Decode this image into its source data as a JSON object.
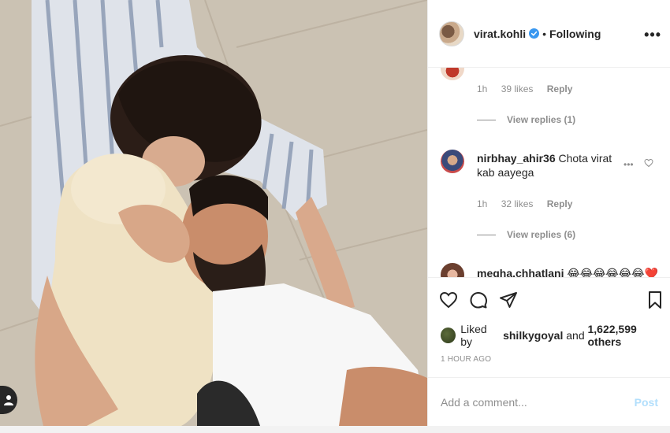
{
  "post": {
    "username": "virat.kohli",
    "separator": "•",
    "follow_status": "Following",
    "more_label": "•••"
  },
  "comments": [
    {
      "likes": "39 likes",
      "time": "1h",
      "reply": "Reply",
      "view_replies": "View replies (1)"
    },
    {
      "username": "nirbhay_ahir36",
      "text": "Chota virat kab aayega",
      "time": "1h",
      "likes": "32 likes",
      "reply": "Reply",
      "view_replies": "View replies (6)",
      "more": "•••"
    },
    {
      "username": "megha.chhatlani",
      "text": "😂😂😂😂😂😂❤️"
    }
  ],
  "likes": {
    "prefix": "Liked by",
    "user": "shilkygoyal",
    "and": "and",
    "count": "1,622,599 others"
  },
  "timestamp": "1 HOUR AGO",
  "add_comment": {
    "placeholder": "Add a comment...",
    "post_label": "Post"
  },
  "icons": [
    "heart-icon",
    "comment-icon",
    "share-icon",
    "bookmark-icon",
    "verified-icon",
    "user-tag-icon"
  ],
  "colors": {
    "verified": "#3897f0",
    "post_button": "#b2dffc",
    "text": "#262626",
    "muted": "#8e8e8e"
  }
}
